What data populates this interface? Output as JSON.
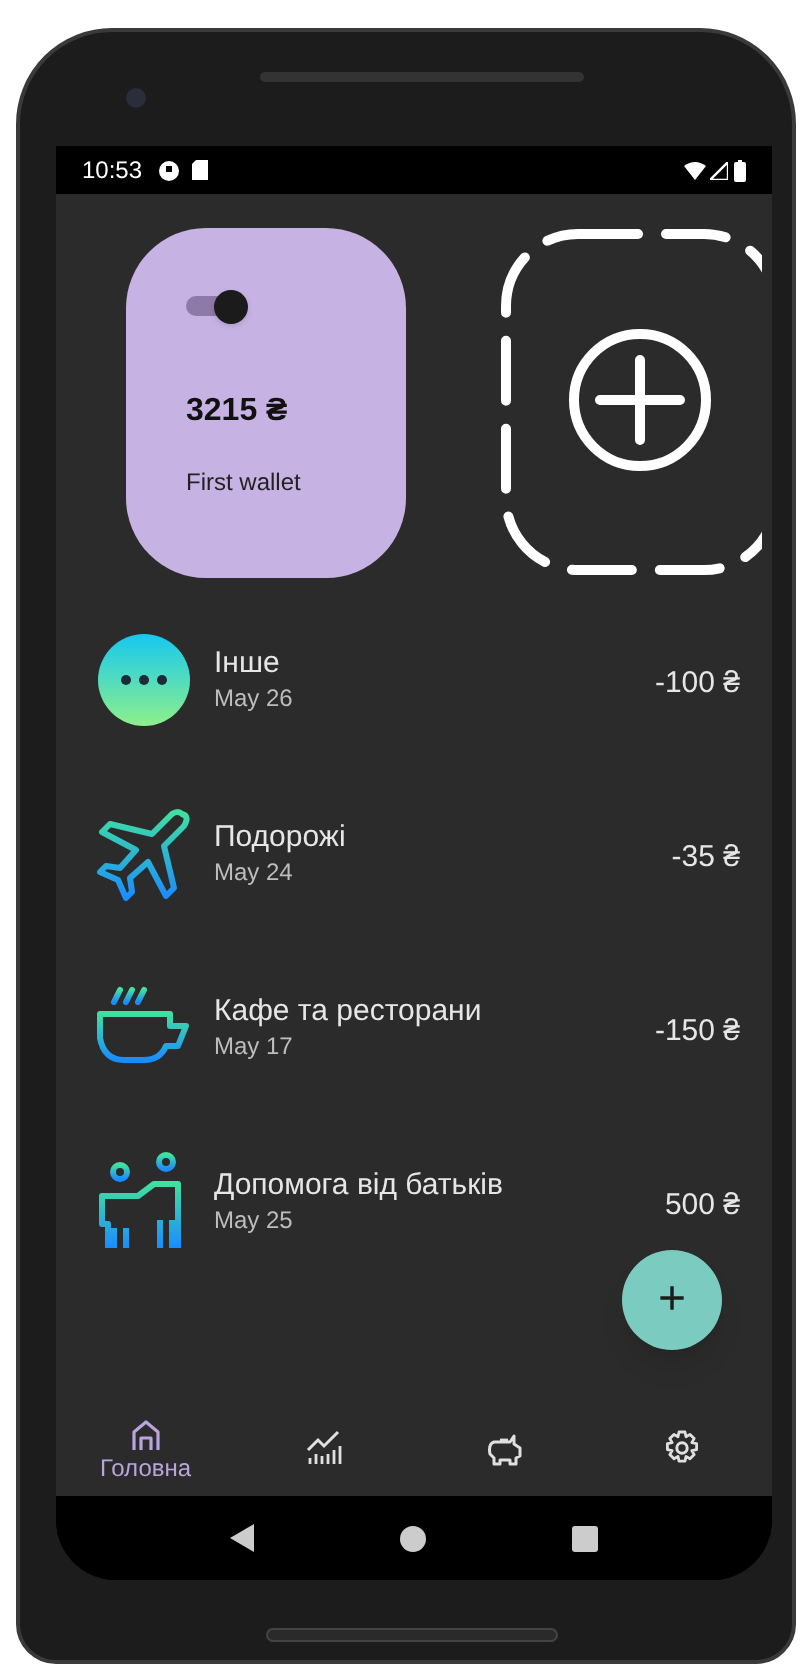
{
  "status_bar": {
    "time": "10:53"
  },
  "wallets": [
    {
      "amount": "3215 ₴",
      "name": "First wallet",
      "enabled": true
    }
  ],
  "transactions": [
    {
      "kind": "other",
      "title": "Інше",
      "date": "May 26",
      "amount": "-100 ₴"
    },
    {
      "kind": "travel",
      "title": "Подорожі",
      "date": "May 24",
      "amount": "-35 ₴"
    },
    {
      "kind": "cafe",
      "title": "Кафе та ресторани",
      "date": "May 17",
      "amount": "-150 ₴"
    },
    {
      "kind": "family",
      "title": "Допомога від батьків",
      "date": "May 25",
      "amount": "500 ₴"
    }
  ],
  "fab": {
    "label": "+"
  },
  "bottom_nav": [
    {
      "kind": "home",
      "label": "Головна",
      "selected": true
    },
    {
      "kind": "stats",
      "selected": false
    },
    {
      "kind": "savings",
      "selected": false
    },
    {
      "kind": "settings",
      "selected": false
    }
  ]
}
